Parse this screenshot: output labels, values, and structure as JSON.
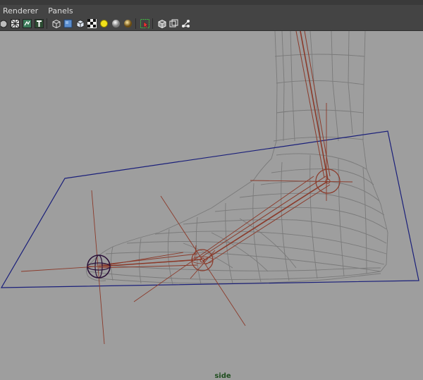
{
  "menubar": {
    "items": [
      {
        "label": "Renderer"
      },
      {
        "label": "Panels"
      }
    ]
  },
  "toolbar": {
    "icons": [
      "camera-icon",
      "grid-icon",
      "bookmark-icon",
      "text-icon",
      "wireframe-cube-icon",
      "smooth-shade-cube-icon",
      "textured-cube-icon",
      "checker-icon",
      "default-light-icon",
      "all-lights-icon",
      "shadow-icon",
      "isolate-select-icon",
      "xray-cube-icon",
      "xray-joints-icon",
      "joint-network-icon"
    ]
  },
  "viewport": {
    "camera_label": "side",
    "colors": {
      "background": "#9e9e9e",
      "mesh_wire": "#7a7a7a",
      "joints": "#8b3a2a",
      "ik_plane": "#1a1f7a",
      "label": "#1f4e1f"
    }
  }
}
